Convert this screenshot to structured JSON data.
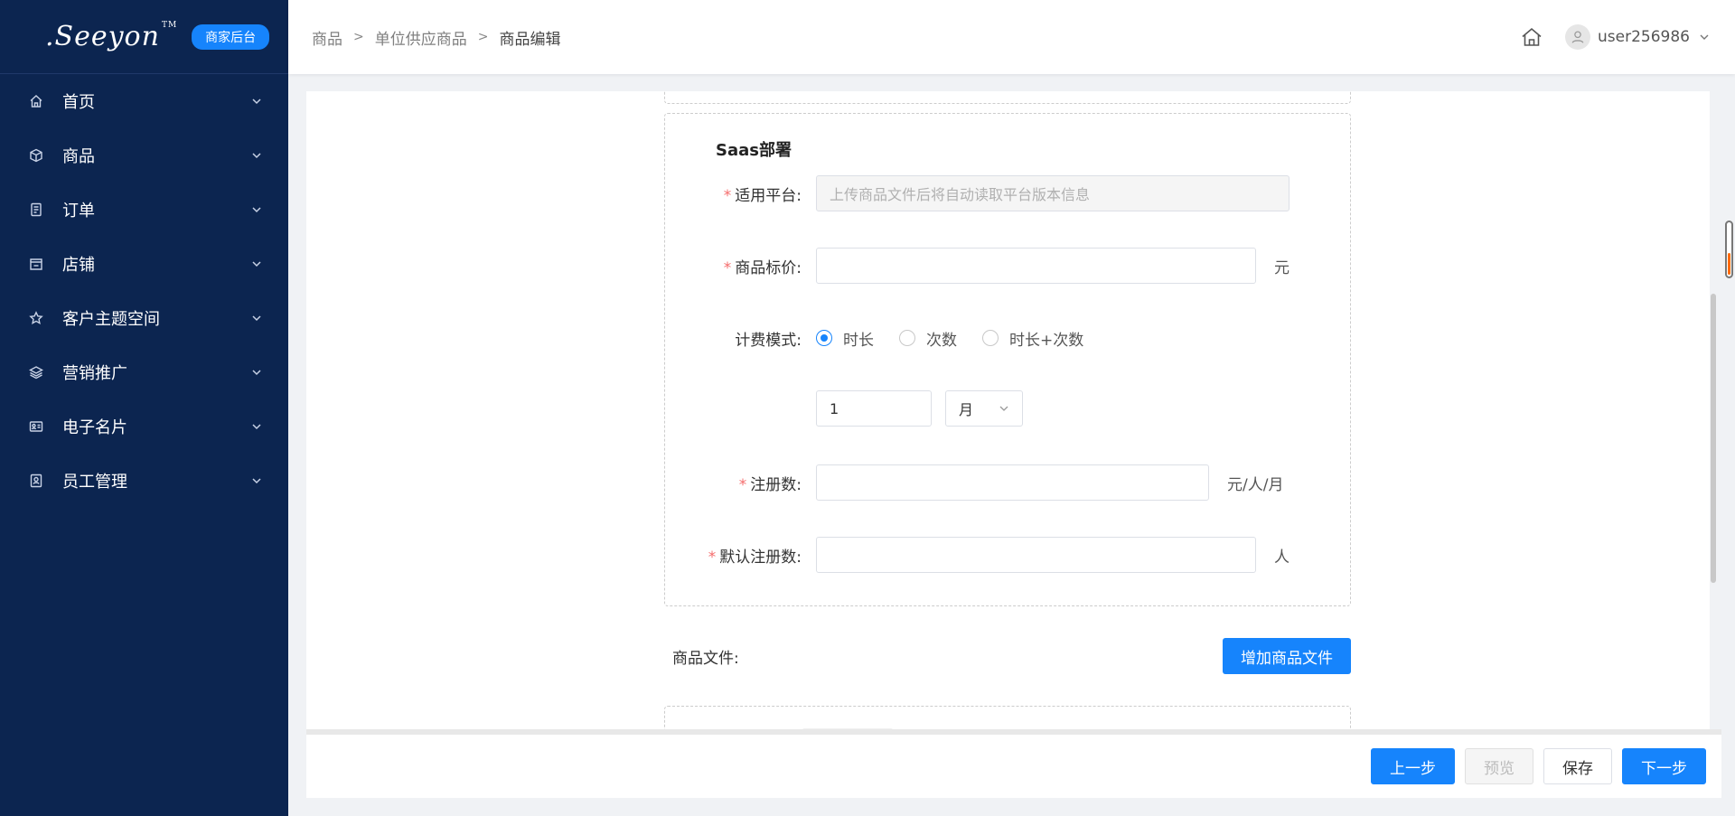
{
  "brand": {
    "logo_text": ".Seeyon",
    "logo_tm": "TM",
    "badge": "商家后台"
  },
  "sidebar": {
    "items": [
      {
        "label": "首页",
        "icon": "home-icon"
      },
      {
        "label": "商品",
        "icon": "cube-icon"
      },
      {
        "label": "订单",
        "icon": "document-icon"
      },
      {
        "label": "店铺",
        "icon": "store-icon"
      },
      {
        "label": "客户主题空间",
        "icon": "star-icon"
      },
      {
        "label": "营销推广",
        "icon": "layers-icon"
      },
      {
        "label": "电子名片",
        "icon": "id-card-icon"
      },
      {
        "label": "员工管理",
        "icon": "person-card-icon"
      }
    ]
  },
  "breadcrumb": {
    "items": [
      "商品",
      "单位供应商品",
      "商品编辑"
    ],
    "separator": ">"
  },
  "header": {
    "username": "user256986"
  },
  "saas": {
    "title": "Saas部署",
    "platform": {
      "label": "适用平台:",
      "placeholder": "上传商品文件后将自动读取平台版本信息"
    },
    "price": {
      "label": "商品标价:",
      "value": "",
      "unit": "元"
    },
    "billing": {
      "label": "计费模式:",
      "options": [
        "时长",
        "次数",
        "时长+次数"
      ],
      "selected": "时长"
    },
    "duration": {
      "value": "1",
      "unit_selected": "月"
    },
    "registration": {
      "label": "注册数:",
      "value": "",
      "unit": "元/人/月"
    },
    "default_registration": {
      "label": "默认注册数:",
      "value": "",
      "unit": "人"
    }
  },
  "files": {
    "label": "商品文件:",
    "add_button": "增加商品文件"
  },
  "footer": {
    "prev": "上一步",
    "preview": "预览",
    "save": "保存",
    "next": "下一步"
  },
  "colors": {
    "sidebar_bg": "#0c2550",
    "primary": "#1684fc",
    "required": "#f56c6c"
  }
}
